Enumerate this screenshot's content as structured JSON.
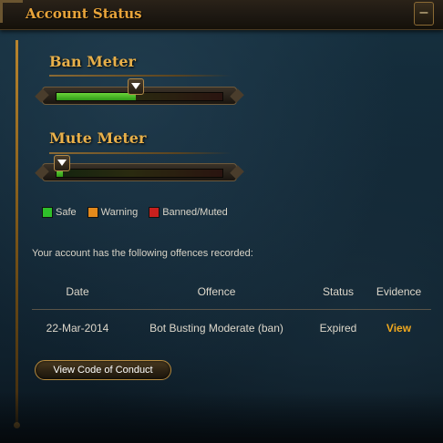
{
  "window": {
    "title": "Account Status",
    "minimize_glyph": "–"
  },
  "meters": {
    "ban": {
      "label": "Ban Meter",
      "level": 0.48
    },
    "mute": {
      "label": "Mute Meter",
      "level": 0.04
    }
  },
  "legend": [
    {
      "label": "Safe",
      "color": "#2fbf2a"
    },
    {
      "label": "Warning",
      "color": "#e38a1c"
    },
    {
      "label": "Banned/Muted",
      "color": "#c9201e"
    }
  ],
  "offences": {
    "intro": "Your account has the following offences recorded:",
    "headers": {
      "date": "Date",
      "offence": "Offence",
      "status": "Status",
      "evidence": "Evidence"
    },
    "rows": [
      {
        "date": "22-Mar-2014",
        "offence": "Bot Busting Moderate (ban)",
        "status": "Expired",
        "evidence": "View"
      }
    ]
  },
  "buttons": {
    "conduct": "View Code of Conduct"
  }
}
